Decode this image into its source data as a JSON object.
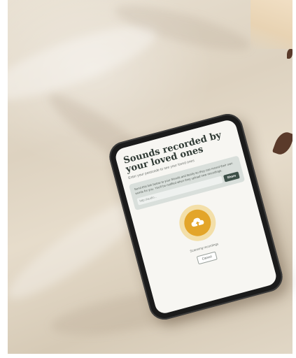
{
  "app": {
    "title": "Sounds recorded by your loved ones",
    "subtitle": "Enter your passcode to see your loved ones",
    "card_text": "Send this link below to your friends and family so they can record their own words for you. You'll be notified when they upload new recordings.",
    "link_placeholder": "http://audio...",
    "share_label": "Share",
    "upload_status": "Scanning recordings",
    "cancel_label": "Cancel"
  },
  "icons": {
    "upload": "cloud-upload-icon"
  },
  "colors": {
    "accent": "#e3a52a",
    "accent_light": "#f3dfa9",
    "title_text": "#2f3a34",
    "share_button": "#3d5048",
    "card_bg": "#d9dfdb"
  }
}
